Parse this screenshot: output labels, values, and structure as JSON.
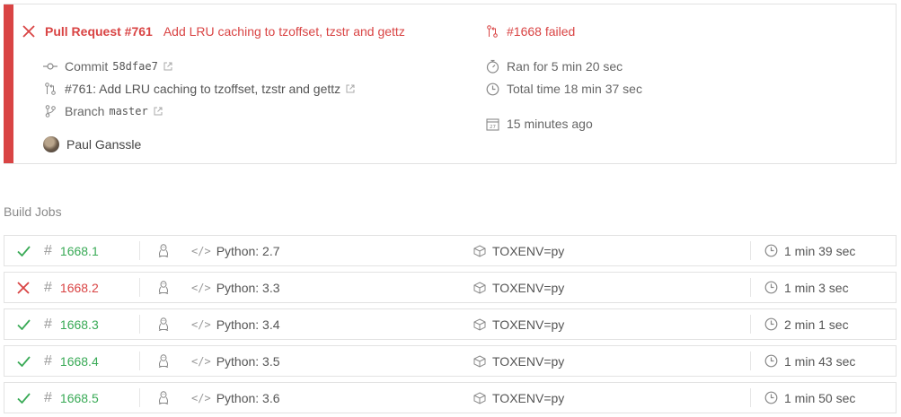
{
  "colors": {
    "failed": "#d94444",
    "passed": "#39aa56",
    "muted": "#666666"
  },
  "summary": {
    "status_icon": "x-icon",
    "title_prefix": "Pull Request #761",
    "title_text": "Add LRU caching to tzoffset, tzstr and gettz",
    "commit_label": "Commit",
    "commit_sha": "58dfae7",
    "pr_link_text": "#761: Add LRU caching to tzoffset, tzstr and gettz",
    "branch_label": "Branch",
    "branch_name": "master",
    "author": "Paul Ganssle",
    "build_status": "#1668 failed",
    "ran_for": "Ran for 5 min 20 sec",
    "total_time": "Total time 18 min 37 sec",
    "ago": "15 minutes ago"
  },
  "build_jobs_title": "Build Jobs",
  "jobs": [
    {
      "status": "passed",
      "number": "1668.1",
      "language": "Python: 2.7",
      "env": "TOXENV=py",
      "duration": "1 min 39 sec"
    },
    {
      "status": "failed",
      "number": "1668.2",
      "language": "Python: 3.3",
      "env": "TOXENV=py",
      "duration": "1 min 3 sec"
    },
    {
      "status": "passed",
      "number": "1668.3",
      "language": "Python: 3.4",
      "env": "TOXENV=py",
      "duration": "2 min 1 sec"
    },
    {
      "status": "passed",
      "number": "1668.4",
      "language": "Python: 3.5",
      "env": "TOXENV=py",
      "duration": "1 min 43 sec"
    },
    {
      "status": "passed",
      "number": "1668.5",
      "language": "Python: 3.6",
      "env": "TOXENV=py",
      "duration": "1 min 50 sec"
    }
  ]
}
